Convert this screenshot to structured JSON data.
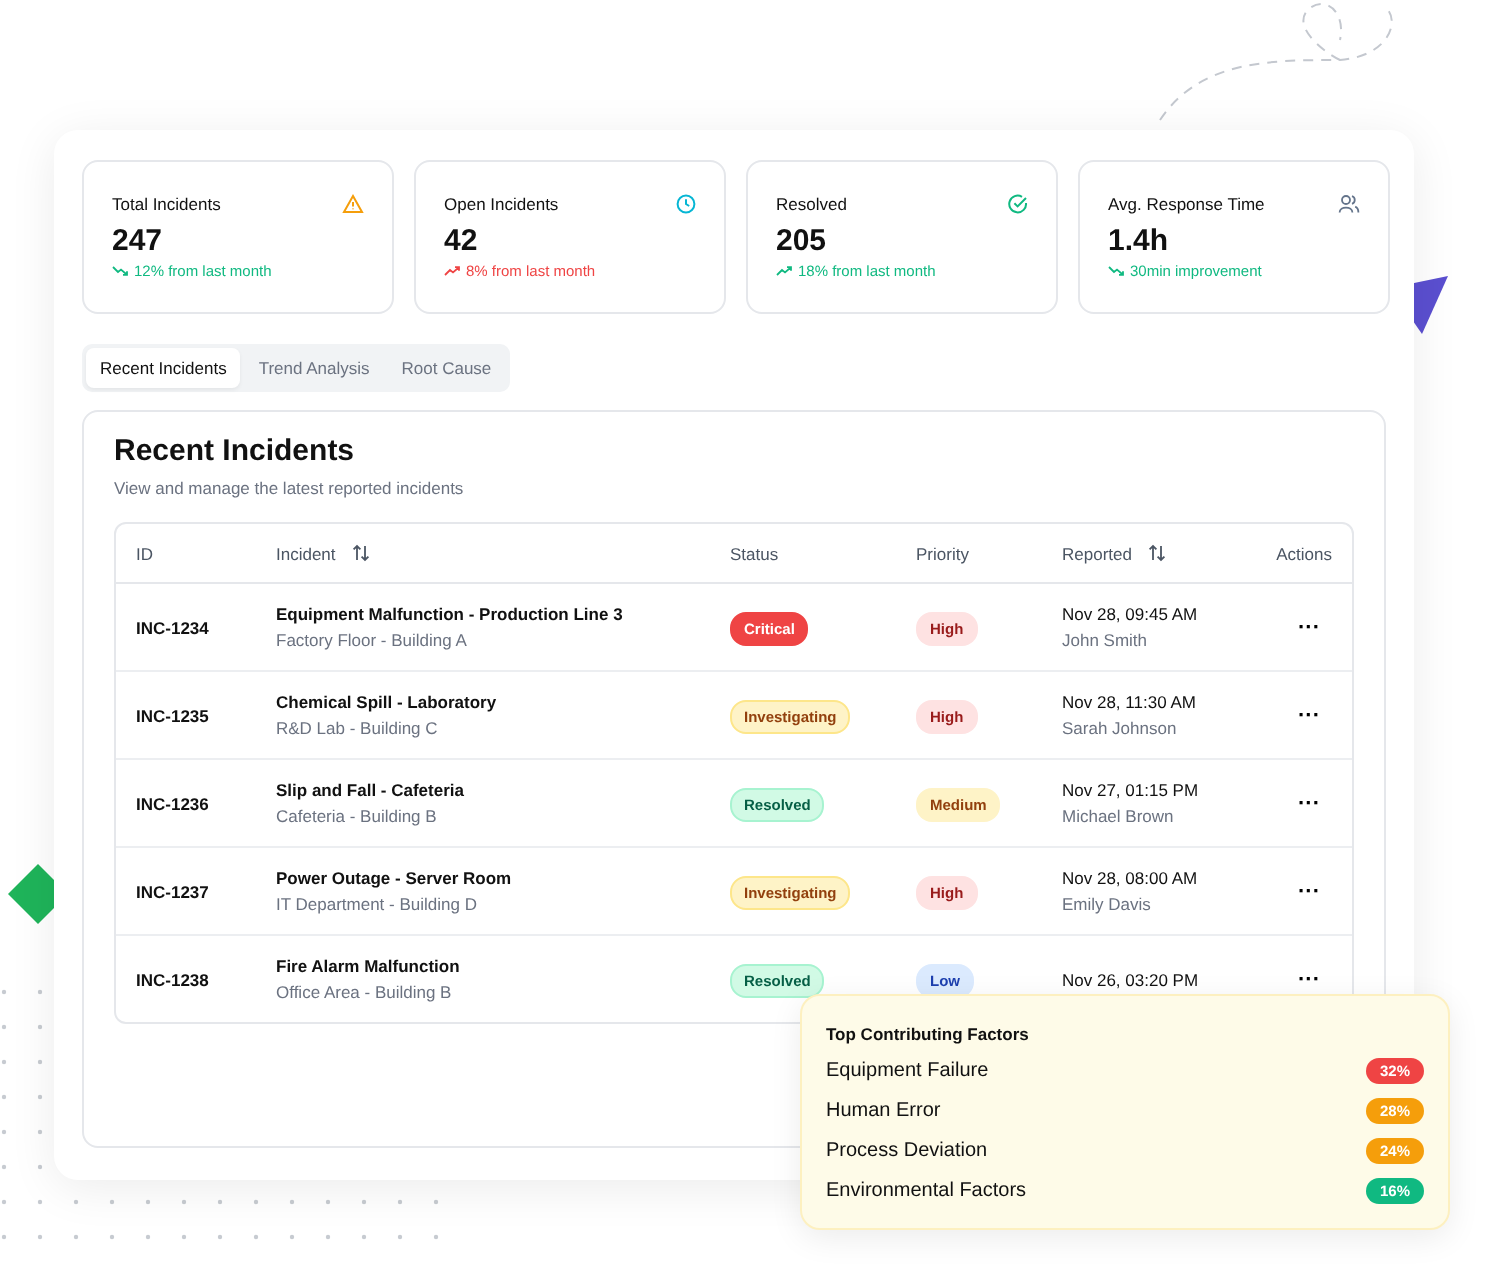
{
  "stats": [
    {
      "kind": "warning",
      "title": "Total Incidents",
      "value": "247",
      "change": {
        "kind": "down",
        "color": "#10b981",
        "text": "12% from last month"
      }
    },
    {
      "kind": "clock",
      "title": "Open Incidents",
      "value": "42",
      "change": {
        "kind": "up",
        "color": "#ef4444",
        "text": "8% from last month"
      }
    },
    {
      "kind": "check",
      "title": "Resolved",
      "value": "205",
      "change": {
        "kind": "up",
        "color": "#10b981",
        "text": "18% from last month"
      }
    },
    {
      "kind": "users",
      "title": "Avg. Response Time",
      "value": "1.4h",
      "change": {
        "kind": "down",
        "color": "#10b981",
        "text": "30min improvement"
      }
    }
  ],
  "tabs": [
    {
      "label": "Recent Incidents",
      "selected": true
    },
    {
      "label": "Trend Analysis",
      "selected": false
    },
    {
      "label": "Root Cause",
      "selected": false
    }
  ],
  "panel": {
    "title": "Recent Incidents",
    "subtitle": "View and manage the latest reported incidents"
  },
  "table": {
    "columns": [
      {
        "label": "ID",
        "sortable": false
      },
      {
        "label": "Incident",
        "sortable": true
      },
      {
        "label": "Status",
        "sortable": false
      },
      {
        "label": "Priority",
        "sortable": false
      },
      {
        "label": "Reported",
        "sortable": true
      },
      {
        "label": "Actions",
        "sortable": false
      }
    ],
    "rows": [
      {
        "id": "INC-1234",
        "incident": "Equipment Malfunction - Production Line 3",
        "location": "Factory Floor - Building A",
        "status": {
          "label": "Critical",
          "kind": "critical"
        },
        "priority": {
          "label": "High",
          "kind": "high"
        },
        "reported": "Nov 28, 09:45 AM",
        "reporter": "John Smith",
        "actions": "···"
      },
      {
        "id": "INC-1235",
        "incident": "Chemical Spill - Laboratory",
        "location": "R&D Lab - Building C",
        "status": {
          "label": "Investigating",
          "kind": "investigating"
        },
        "priority": {
          "label": "High",
          "kind": "high"
        },
        "reported": "Nov 28, 11:30 AM",
        "reporter": "Sarah Johnson",
        "actions": "···"
      },
      {
        "id": "INC-1236",
        "incident": "Slip and Fall - Cafeteria",
        "location": "Cafeteria - Building B",
        "status": {
          "label": "Resolved",
          "kind": "resolved"
        },
        "priority": {
          "label": "Medium",
          "kind": "medium"
        },
        "reported": "Nov 27, 01:15 PM",
        "reporter": "Michael Brown",
        "actions": "···"
      },
      {
        "id": "INC-1237",
        "incident": "Power Outage - Server Room",
        "location": "IT Department - Building D",
        "status": {
          "label": "Investigating",
          "kind": "investigating"
        },
        "priority": {
          "label": "High",
          "kind": "high"
        },
        "reported": "Nov 28, 08:00 AM",
        "reporter": "Emily Davis",
        "actions": "···"
      },
      {
        "id": "INC-1238",
        "incident": "Fire Alarm Malfunction",
        "location": "Office Area - Building B",
        "status": {
          "label": "Resolved",
          "kind": "resolved"
        },
        "priority": {
          "label": "Low",
          "kind": "low"
        },
        "reported": "Nov 26, 03:20 PM",
        "actions": "···"
      }
    ]
  },
  "factors": {
    "title": "Top Contributing Factors",
    "items": [
      {
        "label": "Equipment Failure",
        "share": "32%",
        "color": "#ef4444"
      },
      {
        "label": "Human Error",
        "share": "28%",
        "color": "#f59e0b"
      },
      {
        "label": "Process Deviation",
        "share": "24%",
        "color": "#f59e0b"
      },
      {
        "label": "Environmental Factors",
        "share": "16%",
        "color": "#10b981"
      }
    ]
  }
}
